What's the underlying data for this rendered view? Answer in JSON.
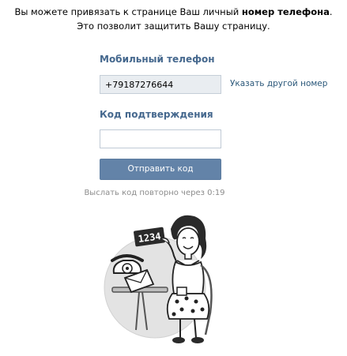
{
  "intro": {
    "line1_prefix": "Вы можете привязать к странице Ваш личный ",
    "line1_bold": "номер телефона",
    "line1_suffix": ".",
    "line2": "Это позволит защитить Вашу страницу."
  },
  "phone": {
    "label": "Мобильный телефон",
    "value": "+79187276644",
    "change_link": "Указать другой номер"
  },
  "code": {
    "label": "Код подтверждения",
    "value": "",
    "placeholder": ""
  },
  "submit_button": {
    "label": "Отправить код"
  },
  "resend": {
    "text": "Выслать код повторно через 0:19"
  },
  "illustration": {
    "sign_text": "1234",
    "colors": {
      "circle": "#e3e3e3",
      "ink": "#222222",
      "accent": "#45688e"
    }
  }
}
